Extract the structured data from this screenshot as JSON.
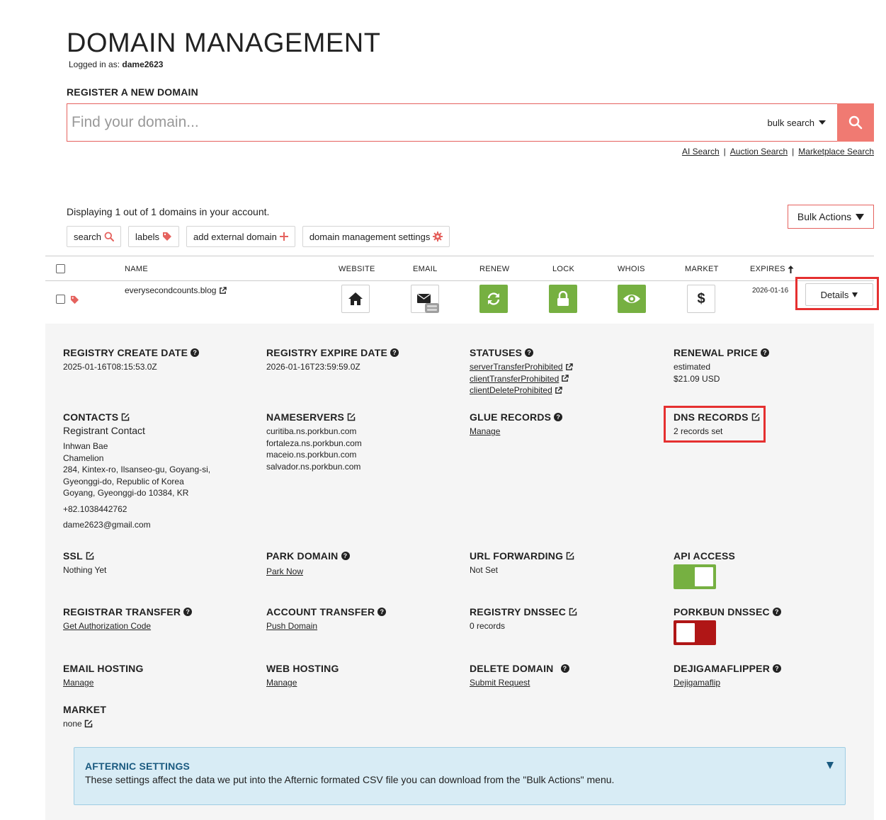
{
  "page": {
    "title": "DOMAIN MANAGEMENT",
    "logged_in_label": "Logged in as:",
    "username": "dame2623"
  },
  "register": {
    "label": "REGISTER A NEW DOMAIN",
    "placeholder": "Find your domain...",
    "bulk_search": "bulk search",
    "links": [
      "AI Search",
      "Auction Search",
      "Marketplace Search"
    ]
  },
  "account": {
    "display_count": "Displaying 1 out of 1 domains in your account.",
    "bulk_actions": "Bulk Actions",
    "toolbar": {
      "search": "search",
      "labels": "labels",
      "add_external": "add external domain",
      "settings": "domain management settings"
    }
  },
  "table": {
    "headers": {
      "name": "NAME",
      "website": "WEBSITE",
      "email": "EMAIL",
      "renew": "RENEW",
      "lock": "LOCK",
      "whois": "WHOIS",
      "market": "MARKET",
      "expires": "EXPIRES"
    },
    "row": {
      "domain": "everysecondcounts.blog",
      "expires": "2026-01-16",
      "details": "Details"
    }
  },
  "details": {
    "registry_create": {
      "title": "REGISTRY CREATE DATE",
      "value": "2025-01-16T08:15:53.0Z"
    },
    "registry_expire": {
      "title": "REGISTRY EXPIRE DATE",
      "value": "2026-01-16T23:59:59.0Z"
    },
    "statuses": {
      "title": "STATUSES",
      "values": [
        "serverTransferProhibited",
        "clientTransferProhibited",
        "clientDeleteProhibited"
      ]
    },
    "renewal_price": {
      "title": "RENEWAL PRICE",
      "line1": "estimated",
      "line2": "$21.09 USD"
    },
    "contacts": {
      "title": "CONTACTS",
      "subtitle": "Registrant Contact",
      "name": "Inhwan Bae",
      "org": "Chamelion",
      "addr1": "284, Kintex-ro, Ilsanseo-gu, Goyang-si,",
      "addr2": "Gyeonggi-do, Republic of Korea",
      "addr3": "Goyang, Gyeonggi-do 10384, KR",
      "phone": "+82.1038442762",
      "email": "dame2623@gmail.com"
    },
    "nameservers": {
      "title": "NAMESERVERS",
      "values": [
        "curitiba.ns.porkbun.com",
        "fortaleza.ns.porkbun.com",
        "maceio.ns.porkbun.com",
        "salvador.ns.porkbun.com"
      ]
    },
    "glue_records": {
      "title": "GLUE RECORDS",
      "link": "Manage"
    },
    "dns_records": {
      "title": "DNS RECORDS",
      "value": "2 records set"
    },
    "ssl": {
      "title": "SSL",
      "value": "Nothing Yet"
    },
    "park_domain": {
      "title": "PARK DOMAIN",
      "link": "Park Now"
    },
    "url_forwarding": {
      "title": "URL FORWARDING",
      "value": "Not Set"
    },
    "api_access": {
      "title": "API ACCESS",
      "state": "on"
    },
    "registrar_transfer": {
      "title": "REGISTRAR TRANSFER",
      "link": "Get Authorization Code"
    },
    "account_transfer": {
      "title": "ACCOUNT TRANSFER",
      "link": "Push Domain"
    },
    "registry_dnssec": {
      "title": "REGISTRY DNSSEC",
      "value": "0 records"
    },
    "porkbun_dnssec": {
      "title": "PORKBUN DNSSEC",
      "state": "off"
    },
    "email_hosting": {
      "title": "EMAIL HOSTING",
      "link": "Manage"
    },
    "web_hosting": {
      "title": "WEB HOSTING",
      "link": "Manage"
    },
    "delete_domain": {
      "title": "DELETE DOMAIN",
      "link": "Submit Request"
    },
    "dejigamaflipper": {
      "title": "DEJIGAMAFLIPPER",
      "link": "Dejigamaflip"
    },
    "market": {
      "title": "MARKET",
      "value": "none"
    }
  },
  "afternic": {
    "title": "AFTERNIC SETTINGS",
    "text": "These settings affect the data we put into the Afternic formated CSV file you can download from the \"Bulk Actions\" menu."
  },
  "colors": {
    "accent": "#e5625e",
    "search_button": "#f07a72",
    "green": "#76b041",
    "red_toggle": "#b01616",
    "highlight": "#e53030",
    "afternic_bg": "#d8ecf5"
  }
}
